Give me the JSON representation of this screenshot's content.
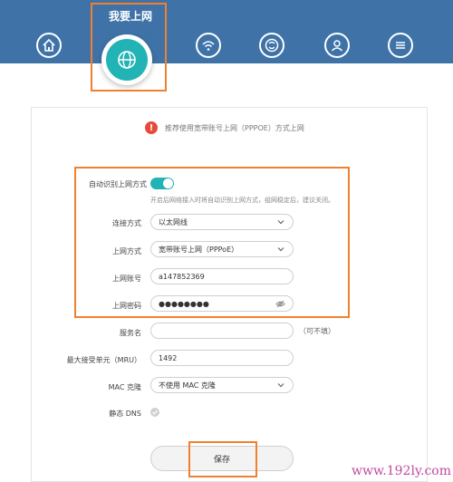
{
  "nav": {
    "active_title": "我要上网",
    "icons": [
      "home-icon",
      "globe-icon",
      "wifi-icon",
      "device-icon",
      "user-icon",
      "menu-icon"
    ]
  },
  "notice": {
    "icon": "!",
    "text": "推荐使用宽带账号上网（PPPOE）方式上网"
  },
  "form": {
    "auto_detect": {
      "label": "自动识别上网方式",
      "enabled": true,
      "hint": "开启后网络接入时将自动识别上网方式，组网稳定后，建议关闭。"
    },
    "connection": {
      "label": "连接方式",
      "value": "以太网线"
    },
    "access_mode": {
      "label": "上网方式",
      "value": "宽带账号上网（PPPoE）"
    },
    "account": {
      "label": "上网账号",
      "value": "a147852369"
    },
    "password": {
      "label": "上网密码",
      "value": "●●●●●●●●"
    },
    "service_name": {
      "label": "服务名",
      "value": "",
      "note": "（可不填）"
    },
    "mru": {
      "label": "最大接受单元（MRU）",
      "value": "1492"
    },
    "mac_clone": {
      "label": "MAC 克隆",
      "value": "不使用 MAC 克隆"
    },
    "static_dns": {
      "label": "静态 DNS"
    }
  },
  "save_label": "保存",
  "watermark": "www.192ly.com",
  "colors": {
    "nav_bg": "#3f73a8",
    "accent": "#22b3b5",
    "highlight": "#f08030",
    "warning": "#e84a3a"
  }
}
